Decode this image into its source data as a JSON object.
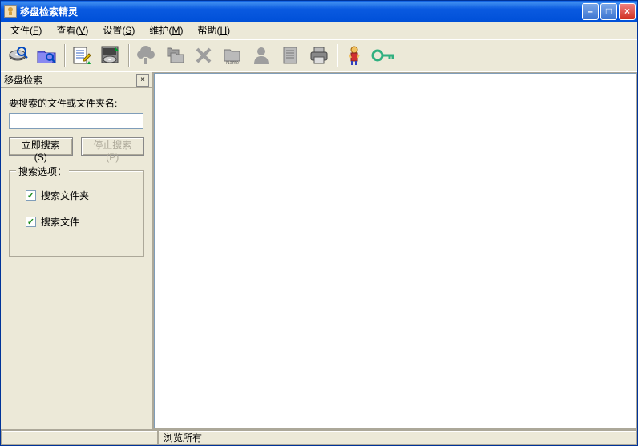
{
  "title": "移盘检索精灵",
  "menus": {
    "file": {
      "label": "文件",
      "key": "F"
    },
    "view": {
      "label": "查看",
      "key": "V"
    },
    "settings": {
      "label": "设置",
      "key": "S"
    },
    "maintain": {
      "label": "维护",
      "key": "M"
    },
    "help": {
      "label": "帮助",
      "key": "H"
    }
  },
  "sidebar": {
    "tab_title": "移盘检索",
    "field_label": "要搜索的文件或文件夹名:",
    "search_btn": "立即搜索(S)",
    "stop_btn": "停止搜索(P)",
    "group_title": "搜索选项：",
    "opt_folders": "搜索文件夹",
    "opt_files": "搜索文件",
    "input_value": ""
  },
  "status": {
    "left": "",
    "right": "浏览所有"
  },
  "win_controls": {
    "min": "–",
    "max": "□",
    "close": "×"
  },
  "checkmark": "✓"
}
